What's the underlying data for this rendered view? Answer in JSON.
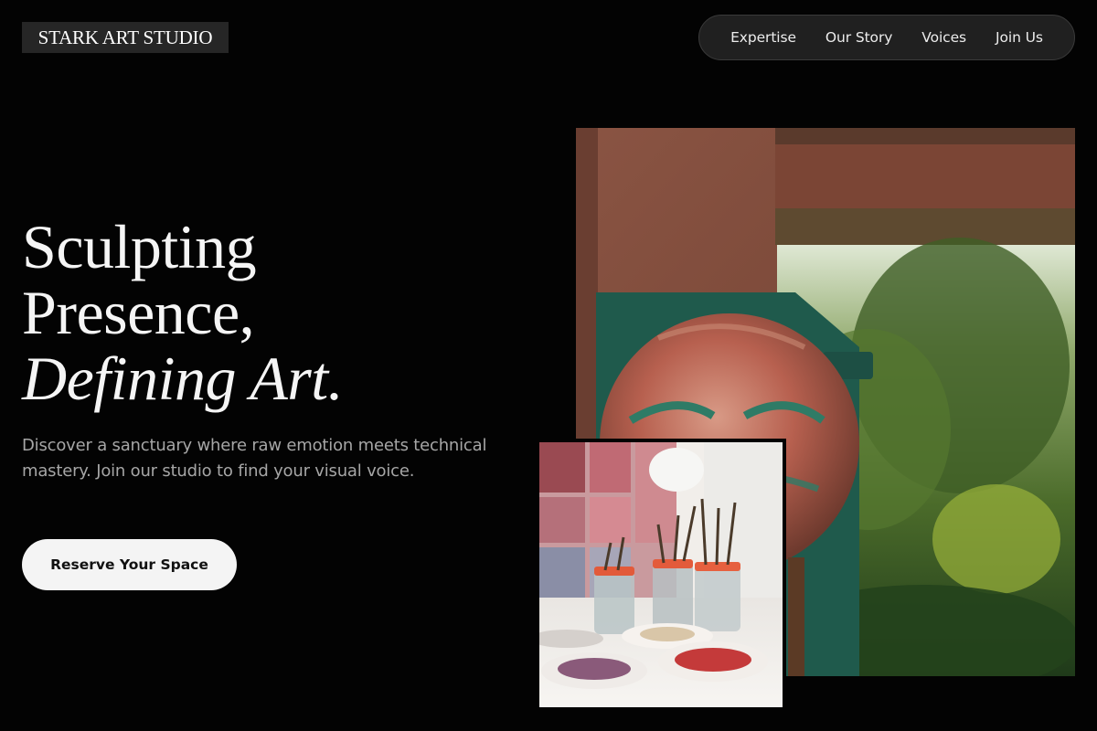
{
  "brand": {
    "name": "STARK ART STUDIO"
  },
  "nav": {
    "items": [
      {
        "label": "Expertise"
      },
      {
        "label": "Our Story"
      },
      {
        "label": "Voices"
      },
      {
        "label": "Join Us"
      }
    ]
  },
  "hero": {
    "title_line1": "Sculpting",
    "title_line2": "Presence,",
    "title_line3": "Defining Art.",
    "subtitle": "Discover a sanctuary where raw emotion meets technical mastery. Join our studio to find your visual voice.",
    "cta_label": "Reserve Your Space"
  },
  "images": {
    "main": {
      "subject": "painted-circular-artwork-studio-window"
    },
    "secondary": {
      "subject": "paint-brush-jars-and-palettes"
    }
  },
  "colors": {
    "background": "#030303",
    "logo_bg": "#262626",
    "nav_bg": "#202020",
    "cta_bg": "#f4f4f4",
    "subtitle_text": "#a6a6a6"
  }
}
